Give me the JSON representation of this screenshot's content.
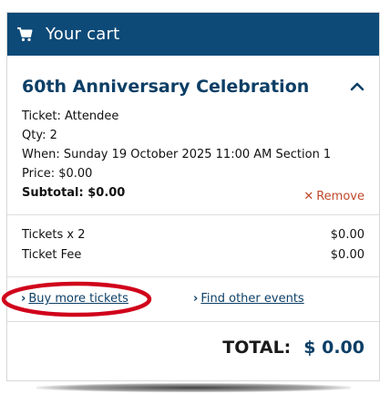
{
  "header": {
    "title": "Your cart",
    "icon": "cart-icon",
    "background_color": "#0d4a78"
  },
  "event": {
    "title": "60th Anniversary Celebration",
    "ticket": "Ticket: Attendee",
    "qty": "Qty: 2",
    "when": "When: Sunday 19 October 2025 11:00 AM Section 1",
    "price": "Price: $0.00",
    "subtotal": "Subtotal: $0.00",
    "remove_label": "Remove",
    "collapse_icon": "chevron-up-icon"
  },
  "fees": [
    {
      "label": "Tickets x 2",
      "amount": "$0.00"
    },
    {
      "label": "Ticket Fee",
      "amount": "$0.00"
    }
  ],
  "links": {
    "buy_more": "Buy more tickets",
    "find_events": "Find other events",
    "highlight_color": "#d0021b"
  },
  "total": {
    "label": "TOTAL:",
    "amount": "$ 0.00"
  },
  "colors": {
    "brand": "#0d4a78",
    "title_text": "#0d3f66",
    "remove": "#c0492b"
  }
}
